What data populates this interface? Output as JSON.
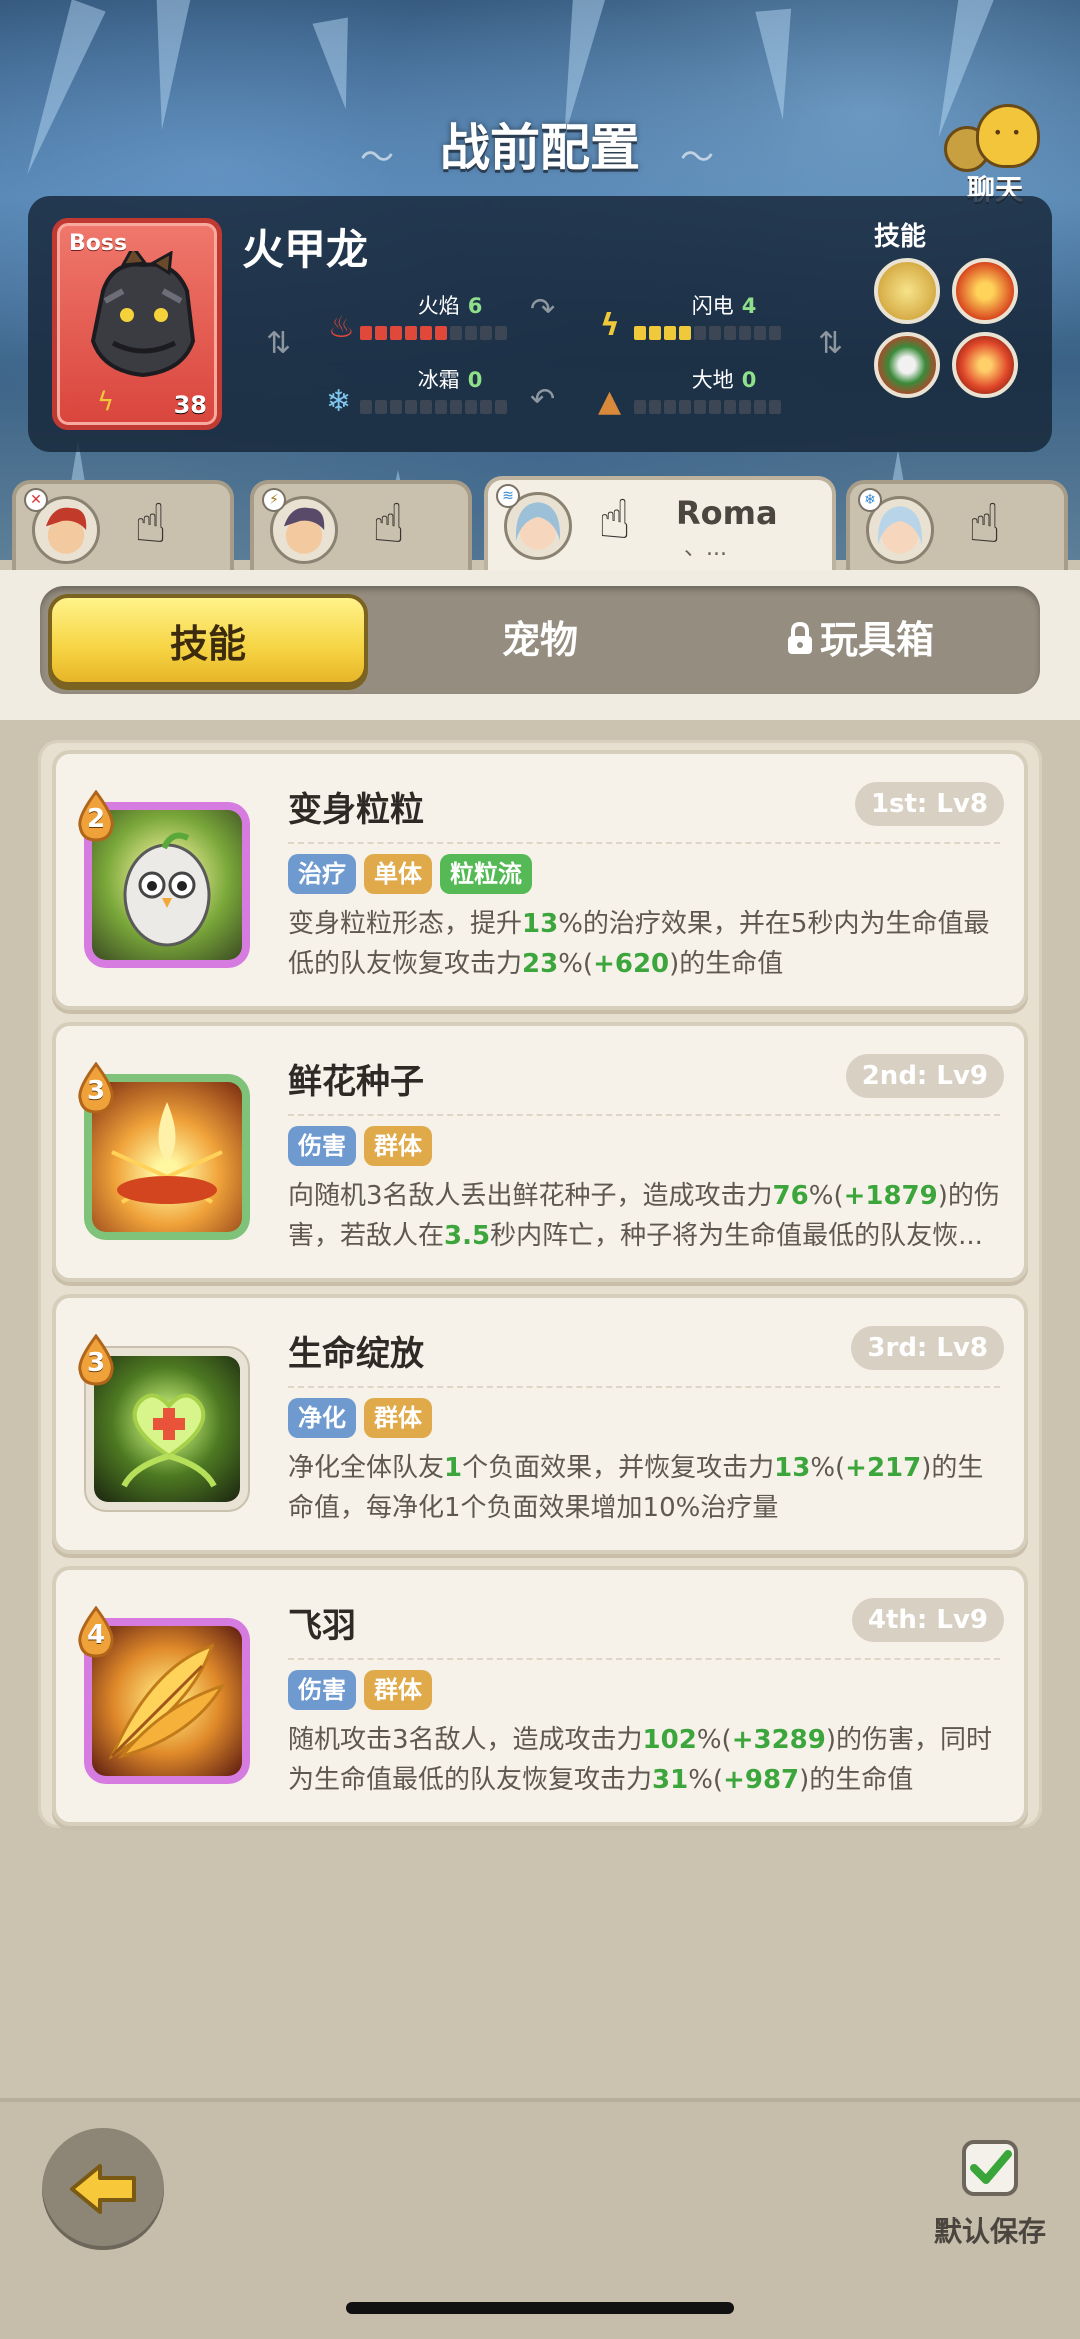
{
  "header": {
    "title": "战前配置",
    "chat_label": "聊天"
  },
  "boss": {
    "tag": "Boss",
    "name": "火甲龙",
    "level": "38",
    "stats": [
      {
        "label": "火焰",
        "value": "6",
        "filled": 6,
        "color": "#e0483a",
        "icon": "flame-icon"
      },
      {
        "label": "闪电",
        "value": "4",
        "filled": 4,
        "color": "#f0c93a",
        "icon": "lightning-icon"
      },
      {
        "label": "冰霜",
        "value": "0",
        "filled": 0,
        "color": "#7fc6ef",
        "icon": "snowflake-icon"
      },
      {
        "label": "大地",
        "value": "0",
        "filled": 0,
        "color": "#d88a3a",
        "icon": "earth-icon"
      }
    ],
    "skills_label": "技能"
  },
  "heroes": [
    {
      "name": "",
      "name_sub": "",
      "active": false
    },
    {
      "name": "",
      "name_sub": "",
      "active": false
    },
    {
      "name": "Roma",
      "name_sub": "、...",
      "active": true
    },
    {
      "name": "",
      "name_sub": "",
      "active": false
    }
  ],
  "tabs": {
    "skills": "技能",
    "pets": "宠物",
    "toys": "玩具箱"
  },
  "skills": [
    {
      "cost": "2",
      "name": "变身粒粒",
      "rank": "1st: Lv8",
      "tags": [
        {
          "text": "治疗",
          "color": "blue"
        },
        {
          "text": "单体",
          "color": "orange"
        },
        {
          "text": "粒粒流",
          "color": "green"
        }
      ],
      "desc": [
        {
          "t": "变身粒粒形态，提升"
        },
        {
          "t": "13",
          "hl": true
        },
        {
          "t": "%的治疗效果，并在5秒内为生命值最低的队友恢复攻击力"
        },
        {
          "t": "23",
          "hl": true
        },
        {
          "t": "%("
        },
        {
          "t": "+620",
          "hl": true
        },
        {
          "t": ")的生命值"
        }
      ]
    },
    {
      "cost": "3",
      "name": "鲜花种子",
      "rank": "2nd: Lv9",
      "tags": [
        {
          "text": "伤害",
          "color": "blue"
        },
        {
          "text": "群体",
          "color": "orange"
        }
      ],
      "desc": [
        {
          "t": "向随机3名敌人丢出鲜花种子，造成攻击力"
        },
        {
          "t": "76",
          "hl": true
        },
        {
          "t": "%("
        },
        {
          "t": "+1879",
          "hl": true
        },
        {
          "t": ")的伤害，若敌人在"
        },
        {
          "t": "3.5",
          "hl": true
        },
        {
          "t": "秒内阵亡，种子将为生命值最低的队友恢..."
        }
      ]
    },
    {
      "cost": "3",
      "name": "生命绽放",
      "rank": "3rd: Lv8",
      "tags": [
        {
          "text": "净化",
          "color": "blue"
        },
        {
          "text": "群体",
          "color": "orange"
        }
      ],
      "desc": [
        {
          "t": "净化全体队友"
        },
        {
          "t": "1",
          "hl": true
        },
        {
          "t": "个负面效果，并恢复攻击力"
        },
        {
          "t": "13",
          "hl": true
        },
        {
          "t": "%("
        },
        {
          "t": "+217",
          "hl": true
        },
        {
          "t": ")的生命值，每净化1个负面效果增加10%治疗量"
        }
      ]
    },
    {
      "cost": "4",
      "name": "飞羽",
      "rank": "4th: Lv9",
      "tags": [
        {
          "text": "伤害",
          "color": "blue"
        },
        {
          "text": "群体",
          "color": "orange"
        }
      ],
      "desc": [
        {
          "t": "随机攻击3名敌人，造成攻击力"
        },
        {
          "t": "102",
          "hl": true
        },
        {
          "t": "%("
        },
        {
          "t": "+3289",
          "hl": true
        },
        {
          "t": ")的伤害，同时为生命值最低的队友恢复攻击力"
        },
        {
          "t": "31",
          "hl": true
        },
        {
          "t": "%("
        },
        {
          "t": "+987",
          "hl": true
        },
        {
          "t": ")的生命值"
        }
      ]
    }
  ],
  "footer": {
    "save_label": "默认保存"
  },
  "colors": {
    "accent_yellow": "#f6d443",
    "highlight_green": "#3ca63c",
    "boss_red": "#d9453d"
  }
}
